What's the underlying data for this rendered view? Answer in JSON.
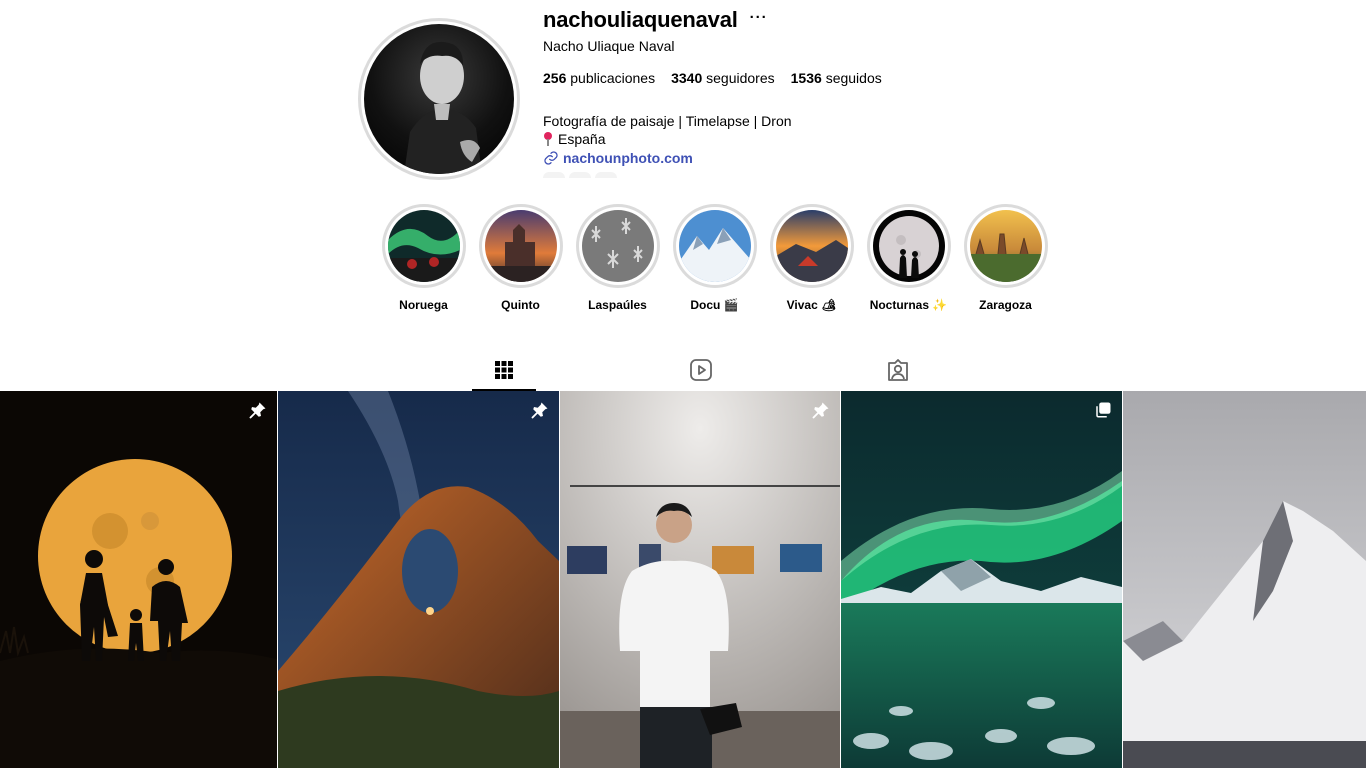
{
  "profile": {
    "username": "nachouliaquenaval",
    "more_label": "···",
    "full_name": "Nacho Uliaque Naval",
    "stats": {
      "posts_count": "256",
      "posts_label": "publicaciones",
      "followers_count": "3340",
      "followers_label": "seguidores",
      "following_count": "1536",
      "following_label": "seguidos"
    },
    "bio_line1": "Fotografía de paisaje | Timelapse | Dron",
    "bio_location": "España",
    "link_text": "nachounphoto.com",
    "link_color": "#3f51b5"
  },
  "highlights": [
    {
      "label": "Noruega"
    },
    {
      "label": "Quinto"
    },
    {
      "label": "Laspaúles"
    },
    {
      "label": "Docu 🎬"
    },
    {
      "label": "Vivac 🏕"
    },
    {
      "label": "Nocturnas ✨"
    },
    {
      "label": "Zaragoza"
    }
  ],
  "tabs": [
    {
      "name": "grid-icon",
      "active": true
    },
    {
      "name": "reels-icon",
      "active": false
    },
    {
      "name": "tagged-icon",
      "active": false
    }
  ],
  "posts": [
    {
      "name": "full-moon-family-silhouette",
      "badge": "pin-icon"
    },
    {
      "name": "milky-way-rock-arch",
      "badge": "pin-icon"
    },
    {
      "name": "photographer-exhibition",
      "badge": "pin-icon"
    },
    {
      "name": "aurora-fjord",
      "badge": "carousel-icon"
    },
    {
      "name": "snowy-mountain-fjord",
      "badge": ""
    }
  ],
  "colors": {
    "ring": "#dbdbdb",
    "text": "#000000",
    "link": "#3f51b5"
  }
}
